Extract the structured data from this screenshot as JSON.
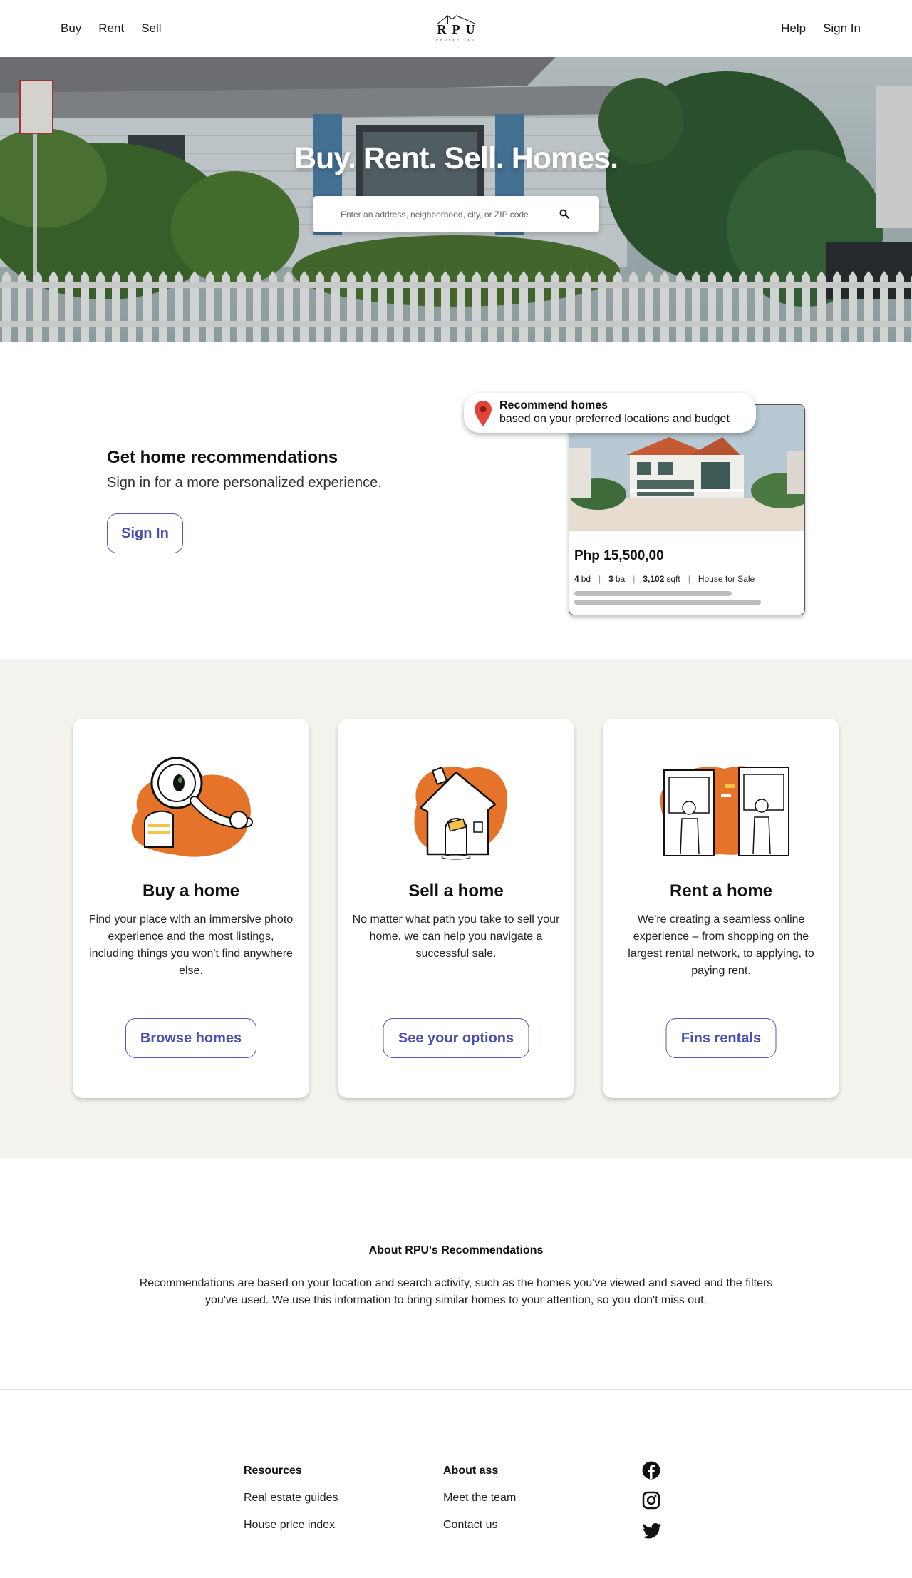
{
  "header": {
    "nav_left": [
      "Buy",
      "Rent",
      "Sell"
    ],
    "logo_text": "RPU",
    "logo_sub": "PROPERTIES",
    "nav_right": [
      "Help",
      "Sign In"
    ]
  },
  "hero": {
    "title": "Buy. Rent. Sell. Homes.",
    "search_placeholder": "Enter an address, neighborhood, city, or ZIP code",
    "search_icon": "search-icon"
  },
  "recommendations": {
    "title": "Get home recommendations",
    "subtitle": "Sign in for a more personalized experience.",
    "signin_label": "Sign In",
    "tooltip": {
      "icon": "location-pin-icon",
      "title": "Recommend homes",
      "body": "based on your preferred locations and budget"
    },
    "listing": {
      "price": "Php 15,500,00",
      "beds_value": "4",
      "beds_unit": "bd",
      "baths_value": "3",
      "baths_unit": "ba",
      "sqft_value": "3,102",
      "sqft_unit": "sqft",
      "type": "House for Sale"
    }
  },
  "services": [
    {
      "title": "Buy a home",
      "description": "Find your place with an immersive photo experience and the most listings, including things you won't find anywhere else.",
      "button": "Browse homes",
      "illustration": "magnifier-person-illustration"
    },
    {
      "title": "Sell a home",
      "description": "No matter what path you take to sell your home, we can help you navigate a successful sale.",
      "button": "See your options",
      "illustration": "house-illustration"
    },
    {
      "title": "Rent a home",
      "description": "We're creating a seamless online experience – from shopping on the largest rental network, to applying, to paying rent.",
      "button": "Fins rentals",
      "illustration": "windows-neighbors-illustration"
    }
  ],
  "about": {
    "title": "About RPU's Recommendations",
    "body": "Recommendations are based on your location and search activity, such as the homes you've viewed and saved and the filters you've used. We use this information to bring similar homes to your attention, so you don't miss out."
  },
  "footer": {
    "resources": {
      "title": "Resources",
      "links": [
        "Real estate guides",
        "House price index"
      ]
    },
    "about": {
      "title": "About ass",
      "links": [
        "Meet the team",
        "Contact us"
      ]
    },
    "social": [
      "facebook-icon",
      "instagram-icon",
      "twitter-icon"
    ]
  },
  "colors": {
    "accent": "#4b4fb3",
    "illustration_orange": "#e5732a",
    "section_bg": "#f4f2ec",
    "pin_red": "#e0443a"
  }
}
